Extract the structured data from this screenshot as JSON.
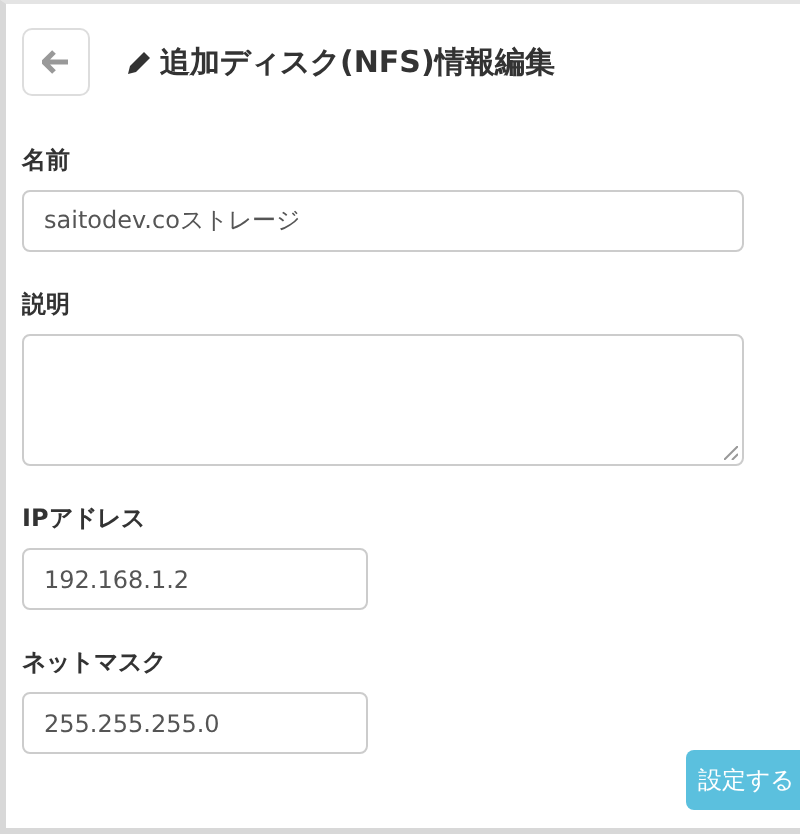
{
  "header": {
    "title": "追加ディスク(NFS)情報編集"
  },
  "fields": [
    {
      "label": "名前",
      "value": "saitodev.coストレージ",
      "kind": "wide"
    },
    {
      "label": "説明",
      "kind": "textarea"
    },
    {
      "label": "IPアドレス",
      "value": "192.168.1.2",
      "kind": "short"
    },
    {
      "label": "ネットマスク",
      "value": "255.255.255.0",
      "kind": "short"
    }
  ],
  "submit": {
    "label": "設定する"
  }
}
